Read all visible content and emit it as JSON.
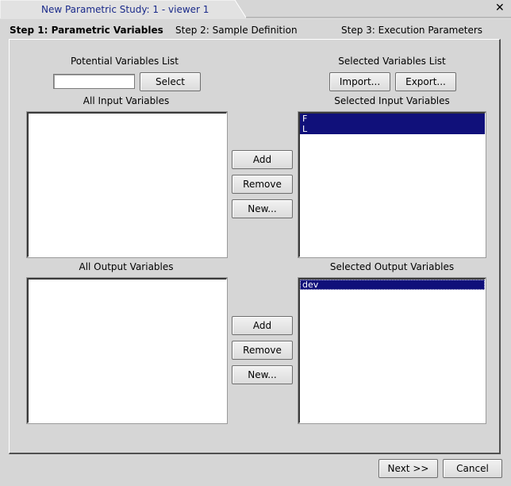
{
  "window": {
    "title": "New Parametric Study: 1 - viewer 1",
    "close_glyph": "✕"
  },
  "steps": [
    {
      "label": "Step 1: Parametric Variables",
      "active": true
    },
    {
      "label": "Step 2: Sample Definition",
      "active": false
    },
    {
      "label": "Step 3: Execution Parameters",
      "active": false
    }
  ],
  "potential": {
    "heading": "Potential Variables List",
    "filter_value": "",
    "select_label": "Select"
  },
  "selected_list": {
    "heading": "Selected Variables List",
    "import_label": "Import...",
    "export_label": "Export..."
  },
  "inputs": {
    "all_heading": "All Input Variables",
    "selected_heading": "Selected Input Variables",
    "all_items": [],
    "selected_items": [
      "F",
      "L"
    ],
    "add_label": "Add",
    "remove_label": "Remove",
    "new_label": "New..."
  },
  "outputs": {
    "all_heading": "All Output Variables",
    "selected_heading": "Selected Output Variables",
    "all_items": [],
    "selected_items": [
      "dev"
    ],
    "add_label": "Add",
    "remove_label": "Remove",
    "new_label": "New..."
  },
  "footer": {
    "next_label": "Next >>",
    "cancel_label": "Cancel"
  },
  "colors": {
    "selection": "#10107a",
    "title_text": "#1a2a8a",
    "background": "#d6d6d6"
  }
}
